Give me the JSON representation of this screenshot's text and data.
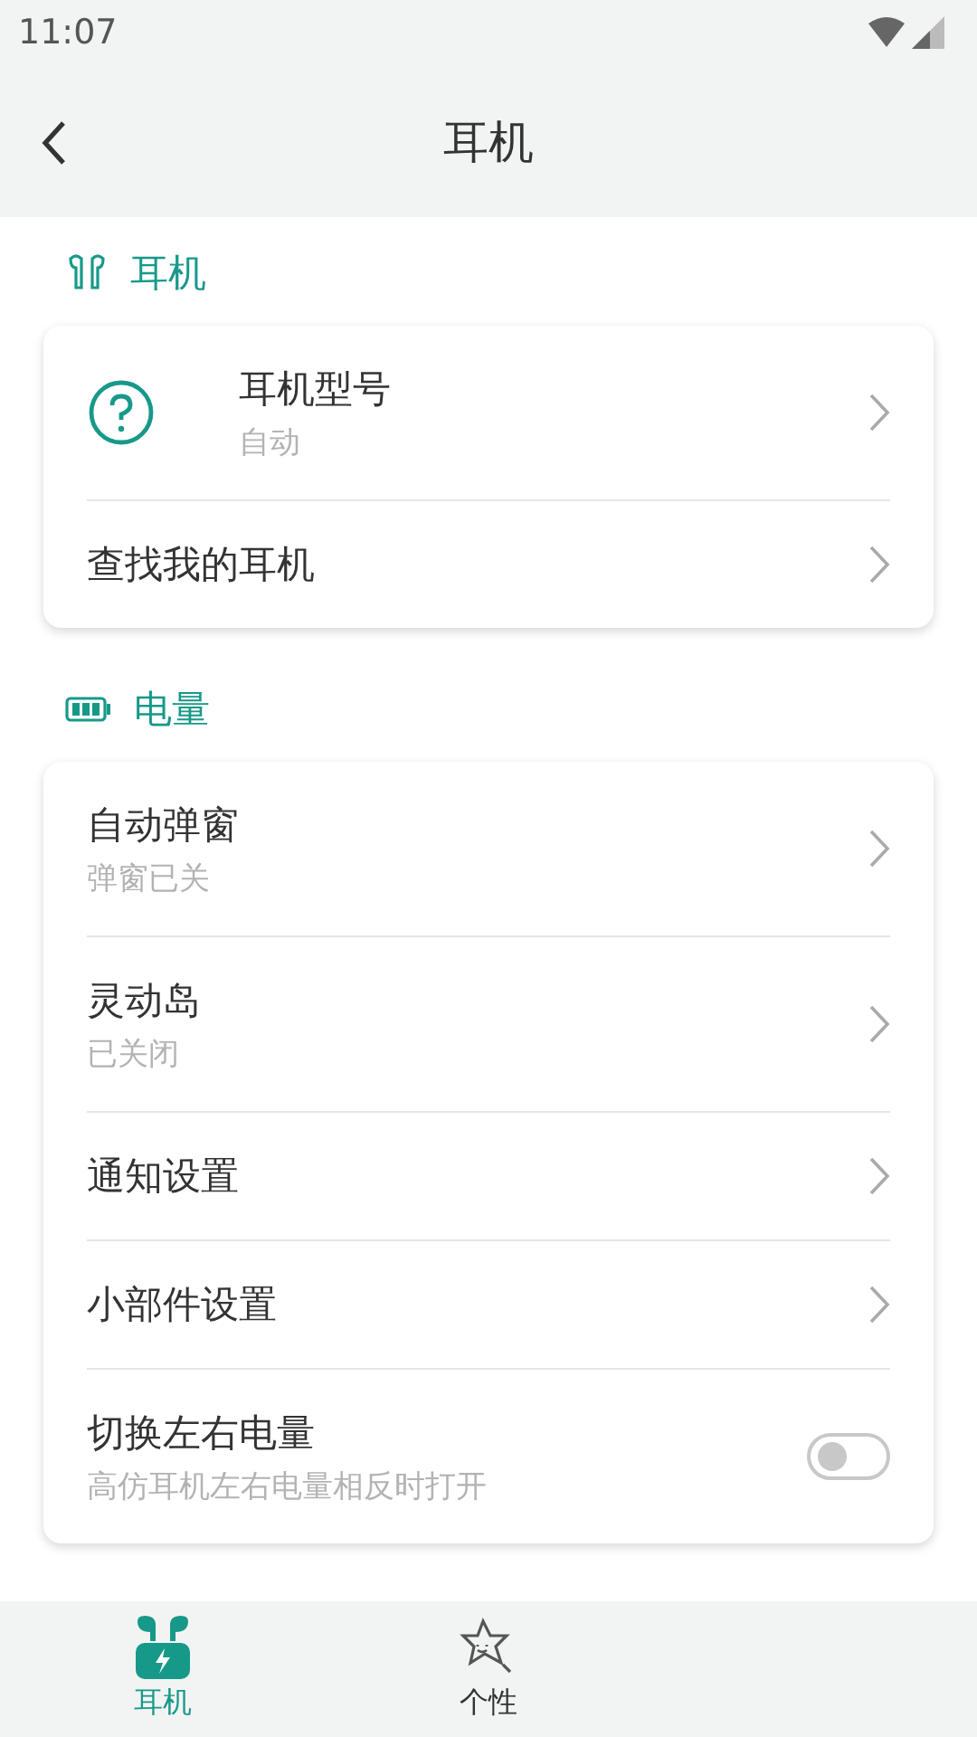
{
  "status_bar": {
    "time": "11:07"
  },
  "app_bar": {
    "title": "耳机"
  },
  "sections": [
    {
      "title": "耳机",
      "items": [
        {
          "kind": "nav",
          "title": "耳机型号",
          "subtitle": "自动"
        },
        {
          "kind": "nav",
          "title": "查找我的耳机"
        }
      ]
    },
    {
      "title": "电量",
      "items": [
        {
          "kind": "nav",
          "title": "自动弹窗",
          "subtitle": "弹窗已关"
        },
        {
          "kind": "nav",
          "title": "灵动岛",
          "subtitle": "已关闭"
        },
        {
          "kind": "nav",
          "title": "通知设置"
        },
        {
          "kind": "nav",
          "title": "小部件设置"
        },
        {
          "kind": "toggle",
          "title": "切换左右电量",
          "subtitle": "高仿耳机左右电量相反时打开",
          "on": false
        }
      ]
    }
  ],
  "bottom_nav": [
    {
      "label": "耳机",
      "selected": true
    },
    {
      "label": "个性",
      "selected": false
    }
  ]
}
